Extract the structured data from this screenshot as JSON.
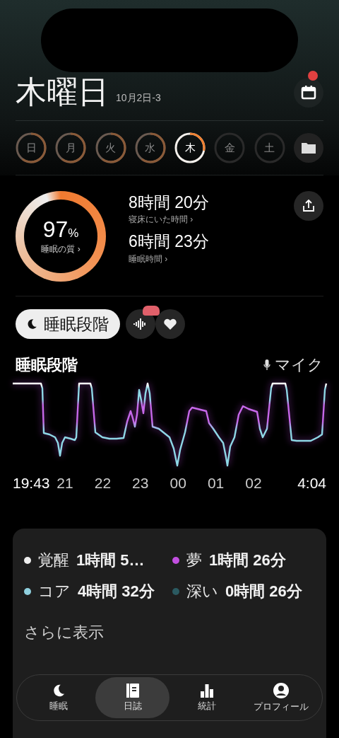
{
  "header": {
    "title": "木曜日",
    "date": "10月2日-3",
    "calendar_badge": true
  },
  "days": [
    {
      "label": "日",
      "recorded": true,
      "selected": false
    },
    {
      "label": "月",
      "recorded": true,
      "selected": false
    },
    {
      "label": "火",
      "recorded": true,
      "selected": false
    },
    {
      "label": "水",
      "recorded": true,
      "selected": false
    },
    {
      "label": "木",
      "recorded": true,
      "selected": true
    },
    {
      "label": "金",
      "recorded": false,
      "selected": false
    },
    {
      "label": "土",
      "recorded": false,
      "selected": false
    }
  ],
  "summary": {
    "score": "97",
    "unit": "%",
    "score_label": "睡眠の質 ›",
    "stats": [
      {
        "value": "8時間 20分",
        "label": "寝床にいた時間 ›"
      },
      {
        "value": "6時間 23分",
        "label": "睡眠時間 ›"
      }
    ]
  },
  "view_tabs": [
    {
      "label": "睡眠段階",
      "selected": true
    }
  ],
  "chart": {
    "title": "睡眠段階",
    "source": "マイク",
    "time_labels": [
      "19:43",
      "21",
      "22",
      "23",
      "00",
      "01",
      "02",
      "4:04"
    ]
  },
  "legend": [
    {
      "name": "覚醒",
      "value": "1時間 5…",
      "color": "#eeeeee"
    },
    {
      "name": "夢",
      "value": "1時間 26分",
      "color": "#c24fe0"
    },
    {
      "name": "コア",
      "value": "4時間 32分",
      "color": "#8fd0de"
    },
    {
      "name": "深い",
      "value": "0時間 26分",
      "color": "#2b5a61"
    }
  ],
  "more": "さらに表示",
  "tab_bar": [
    {
      "label": "睡眠",
      "selected": false
    },
    {
      "label": "日誌",
      "selected": true
    },
    {
      "label": "統計",
      "selected": false
    },
    {
      "label": "プロフィール",
      "selected": false
    }
  ]
}
